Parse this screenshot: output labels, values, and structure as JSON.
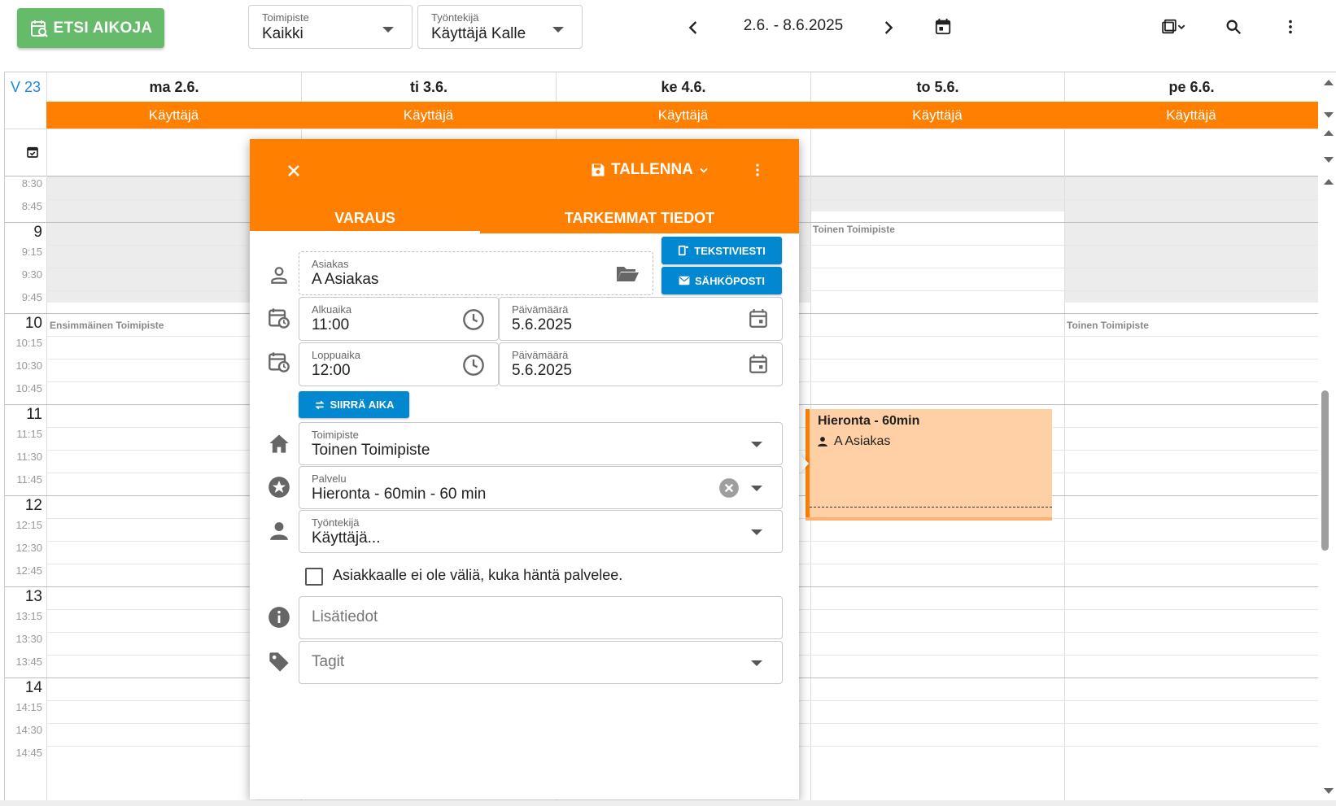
{
  "toolbar": {
    "search_times_label": "ETSI AIKOJA",
    "location_filter": {
      "label": "Toimipiste",
      "value": "Kaikki"
    },
    "employee_filter": {
      "label": "Työntekijä",
      "value": "Käyttäjä Kalle"
    },
    "date_range": "2.6. - 8.6.2025",
    "icons": [
      "calendar-search-icon",
      "chevron-left-icon",
      "chevron-right-icon",
      "calendar-today-icon",
      "calendar-view-icon",
      "search-icon",
      "more-vert-icon"
    ]
  },
  "calendar": {
    "week_label": "V 23",
    "days": [
      {
        "label": "ma 2.6.",
        "user": "Käyttäjä"
      },
      {
        "label": "ti 3.6.",
        "user": "Käyttäjä"
      },
      {
        "label": "ke 4.6.",
        "user": "Käyttäjä"
      },
      {
        "label": "to 5.6.",
        "user": "Käyttäjä"
      },
      {
        "label": "pe 6.6.",
        "user": "Käyttäjä"
      }
    ],
    "time_labels": [
      "8:30",
      "8:45",
      "9",
      "9:15",
      "9:30",
      "9:45",
      "10",
      "10:15",
      "10:30",
      "10:45",
      "11",
      "11:15",
      "11:30",
      "11:45",
      "12",
      "12:15",
      "12:30",
      "12:45",
      "13",
      "13:15",
      "13:30",
      "13:45",
      "14",
      "14:15",
      "14:30",
      "14:45"
    ],
    "location_labels": {
      "mon_10": "Ensimmäinen Toimipiste",
      "thu_9": "Toinen Toimipiste",
      "fri_10": "Toinen Toimipiste"
    },
    "event": {
      "title": "Hieronta - 60min",
      "client": "A Asiakas"
    }
  },
  "dialog": {
    "save_label": "TALLENNA",
    "tabs": [
      {
        "label": "VARAUS",
        "active": true
      },
      {
        "label": "TARKEMMAT TIEDOT",
        "active": false
      }
    ],
    "sms_button": "TEKSTIVIESTI",
    "email_button": "SÄHKÖPOSTI",
    "client": {
      "label": "Asiakas",
      "value": "A Asiakas"
    },
    "start_time": {
      "label": "Alkuaika",
      "value": "11:00"
    },
    "start_date": {
      "label": "Päivämäärä",
      "value": "5.6.2025"
    },
    "end_time": {
      "label": "Loppuaika",
      "value": "12:00"
    },
    "end_date": {
      "label": "Päivämäärä",
      "value": "5.6.2025"
    },
    "move_time_button": "SIIRRÄ AIKA",
    "location": {
      "label": "Toimipiste",
      "value": "Toinen Toimipiste"
    },
    "service": {
      "label": "Palvelu",
      "value": "Hieronta - 60min - 60 min"
    },
    "employee": {
      "label": "Työntekijä",
      "value": "Käyttäjä..."
    },
    "any_employee_checkbox": {
      "label": "Asiakkaalle ei ole väliä, kuka häntä palvelee.",
      "checked": false
    },
    "additional_info": {
      "placeholder": "Lisätiedot"
    },
    "tags": {
      "placeholder": "Tagit"
    }
  },
  "colors": {
    "brand_orange": "#ff7f00",
    "green": "#66bb6a",
    "blue": "#0288d1",
    "event_fill": "#ffd0a5"
  }
}
